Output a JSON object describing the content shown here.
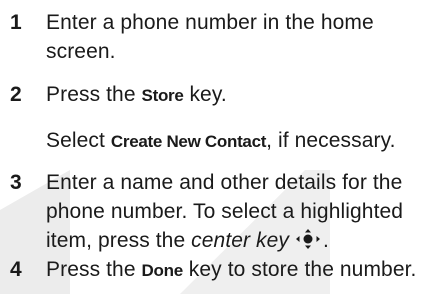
{
  "steps": [
    {
      "num": "1",
      "lines": [
        "Enter a phone number in the home",
        "screen."
      ]
    },
    {
      "num": "2",
      "line1_pre": "Press the ",
      "line1_key": "Store",
      "line1_post": " key.",
      "line2_pre": "Select ",
      "line2_key": "Create New Contact",
      "line2_post": ", if necessary."
    },
    {
      "num": "3",
      "lines": [
        "Enter a name and other details for the",
        "phone number. To select a highlighted"
      ],
      "line3_pre": "item, press the ",
      "line3_ital": "center key",
      "line3_post": "."
    },
    {
      "num": "4",
      "line1_pre": "Press the ",
      "line1_key": "Done",
      "line1_post": " key to store the number."
    }
  ],
  "icons": {
    "center_key": "nav-center-key-icon"
  },
  "colors": {
    "text": "#1a1a1a",
    "watermark": "#ececec"
  }
}
